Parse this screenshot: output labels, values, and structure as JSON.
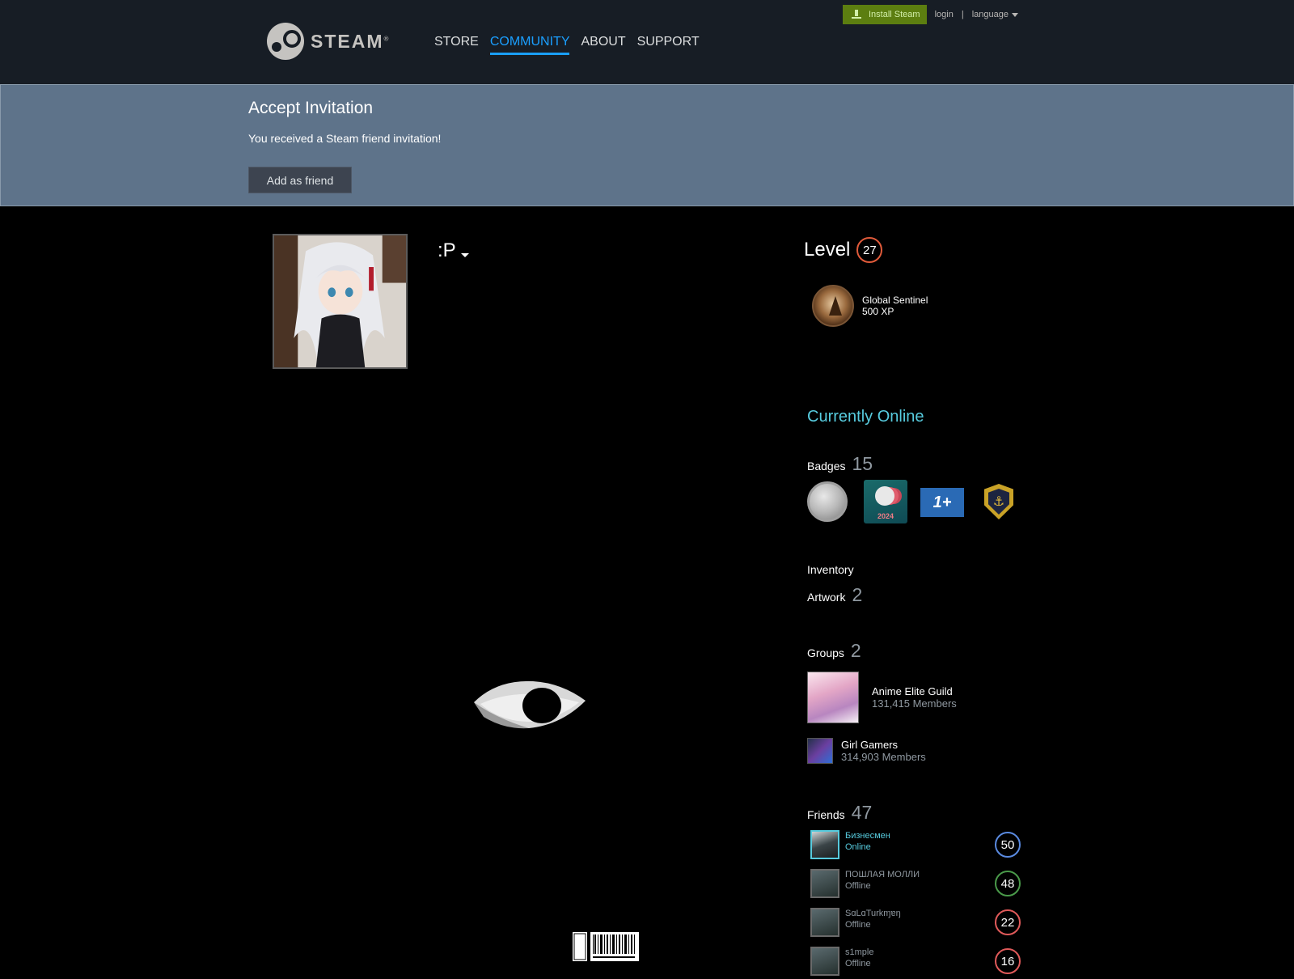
{
  "header": {
    "logo_text": "STEAM",
    "logo_mark": "®",
    "nav": [
      "STORE",
      "COMMUNITY",
      "ABOUT",
      "SUPPORT"
    ],
    "install_label": "Install Steam",
    "login_label": "login",
    "separator": "|",
    "language_label": "language"
  },
  "invitation": {
    "title": "Accept Invitation",
    "message": "You received a Steam friend invitation!",
    "button_label": "Add as friend"
  },
  "profile": {
    "persona_name": ":P"
  },
  "sidebar": {
    "level_label": "Level",
    "level_value": "27",
    "favorite_badge": {
      "name": "Global Sentinel",
      "xp": "500 XP"
    },
    "online_status": "Currently Online",
    "badges_label": "Badges",
    "badges_count": "15",
    "badge_2024_text": "2024",
    "badge_1plus_text": "1+",
    "badge_shield_glyph": "⚓",
    "inventory_label": "Inventory",
    "artwork_label": "Artwork",
    "artwork_count": "2",
    "groups_label": "Groups",
    "groups_count": "2",
    "groups": [
      {
        "name": "Anime Elite Guild",
        "members": "131,415 Members"
      },
      {
        "name": "Girl Gamers",
        "members": "314,903 Members"
      }
    ],
    "friends_label": "Friends",
    "friends_count": "47",
    "friends": [
      {
        "name": "Бизнесмен",
        "status": "Online",
        "level": "50",
        "level_color": "#5a8ae0"
      },
      {
        "name": "ПОШЛАЯ МОЛЛИ",
        "status": "Offline",
        "level": "48",
        "level_color": "#4a9a4a"
      },
      {
        "name": "SɑLɑTurkɱɐŋ",
        "status": "Offline",
        "level": "22",
        "level_color": "#e05a5a"
      },
      {
        "name": "s1mple",
        "status": "Offline",
        "level": "16",
        "level_color": "#e05a5a"
      }
    ]
  },
  "icons": {
    "logo": "steam-logo-icon",
    "install": "download-icon",
    "dropdown": "chevron-down-icon"
  }
}
